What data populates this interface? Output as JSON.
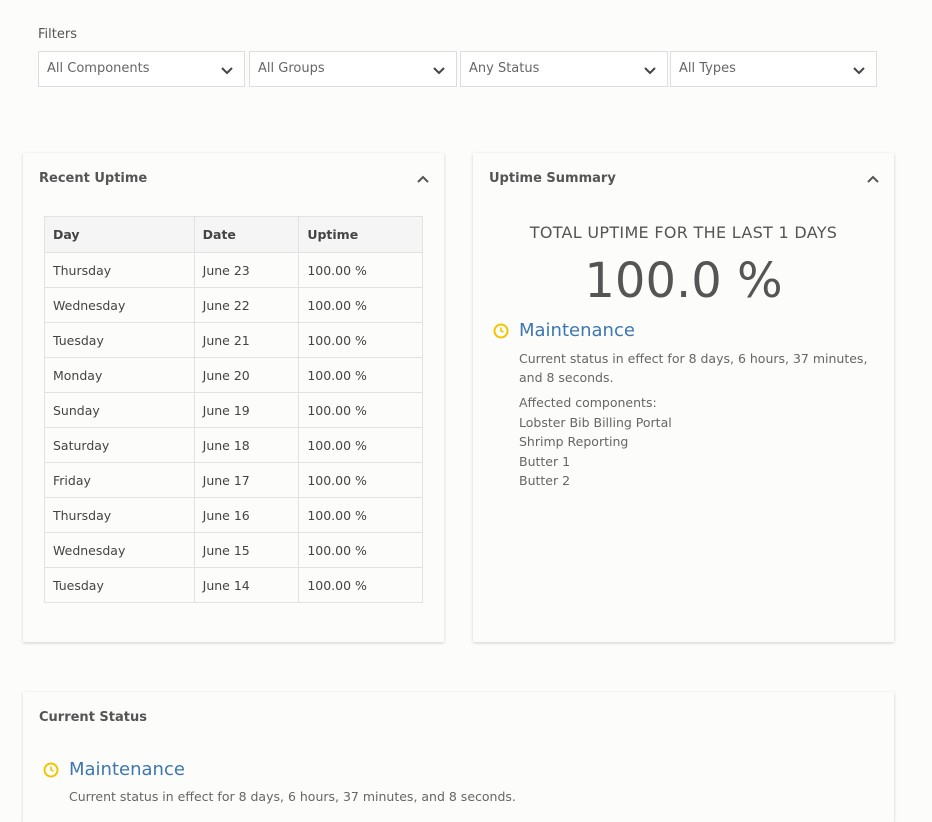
{
  "filters": {
    "label": "Filters",
    "components": "All Components",
    "groups": "All Groups",
    "status": "Any Status",
    "types": "All Types"
  },
  "recent_uptime": {
    "title": "Recent Uptime",
    "columns": [
      "Day",
      "Date",
      "Uptime"
    ],
    "rows": [
      {
        "day": "Thursday",
        "date": "June 23",
        "uptime": "100.00 %"
      },
      {
        "day": "Wednesday",
        "date": "June 22",
        "uptime": "100.00 %"
      },
      {
        "day": "Tuesday",
        "date": "June 21",
        "uptime": "100.00 %"
      },
      {
        "day": "Monday",
        "date": "June 20",
        "uptime": "100.00 %"
      },
      {
        "day": "Sunday",
        "date": "June 19",
        "uptime": "100.00 %"
      },
      {
        "day": "Saturday",
        "date": "June 18",
        "uptime": "100.00 %"
      },
      {
        "day": "Friday",
        "date": "June 17",
        "uptime": "100.00 %"
      },
      {
        "day": "Thursday",
        "date": "June 16",
        "uptime": "100.00 %"
      },
      {
        "day": "Wednesday",
        "date": "June 15",
        "uptime": "100.00 %"
      },
      {
        "day": "Tuesday",
        "date": "June 14",
        "uptime": "100.00 %"
      }
    ]
  },
  "uptime_summary": {
    "title": "Uptime Summary",
    "heading": "TOTAL UPTIME FOR THE LAST 1 DAYS",
    "value": "100.0 %",
    "status_name": "Maintenance",
    "status_text": "Current status in effect for 8 days, 6 hours, 37 minutes, and 8 seconds.",
    "affected_label": "Affected components:",
    "components": [
      "Lobster Bib Billing Portal",
      "Shrimp Reporting",
      "Butter 1",
      "Butter 2"
    ]
  },
  "current_status": {
    "title": "Current Status",
    "status_name": "Maintenance",
    "status_text": "Current status in effect for 8 days, 6 hours, 37 minutes, and 8 seconds."
  },
  "colors": {
    "status_icon": "#f2c500",
    "status_name": "#3d77b0"
  },
  "icons": {
    "dropdown": "chevron-down-icon",
    "collapse": "chevron-up-icon",
    "status": "clock-icon"
  }
}
